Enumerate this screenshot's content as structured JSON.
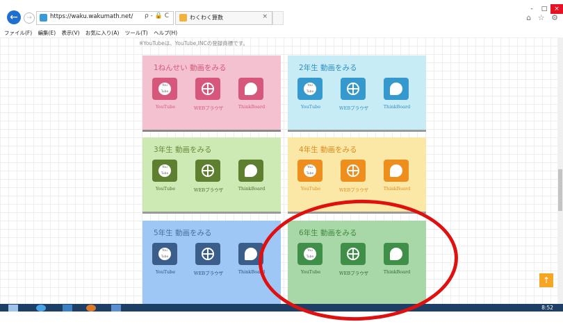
{
  "browser": {
    "url": "https://waku.wakumath.net/",
    "address_controls": "ρ - 🔒 C",
    "tab_title": "わくわく算数",
    "tab_close": "×",
    "window_controls": [
      "-",
      "□",
      "×"
    ],
    "right_icons": "⌂ ☆ ⚙"
  },
  "menu": [
    "ファイル(F)",
    "編集(E)",
    "表示(V)",
    "お気に入り(A)",
    "ツール(T)",
    "ヘルプ(H)"
  ],
  "notice": "※YouTubeは、YouTube,INCの登録商標です。",
  "button_icons": {
    "youtube": "youtube-icon",
    "web": "globe-icon",
    "think": "thinkboard-icon",
    "youtube_glyph": "You Tube"
  },
  "panels": [
    {
      "id": "grade1",
      "title": "1ねんせい 動画をみる",
      "color": "#f3c1cf"
    },
    {
      "id": "grade2",
      "title": "2年生 動画をみる",
      "color": "#c8ecf6"
    },
    {
      "id": "grade3",
      "title": "3年生 動画をみる",
      "color": "#cdeab5"
    },
    {
      "id": "grade4",
      "title": "4年生 動画をみる",
      "color": "#fbe8a6"
    },
    {
      "id": "grade5",
      "title": "5年生 動画をみる",
      "color": "#9ec7f5"
    },
    {
      "id": "grade6",
      "title": "6年生 動画をみる",
      "color": "#a8d8a8"
    }
  ],
  "labels": {
    "youtube": "YouTube",
    "web": "WEBブラウザ",
    "think": "ThinkBoard"
  },
  "page_top_arrow": "↑",
  "taskbar": {
    "clock": "8:52"
  },
  "annotation_color": "#e01010"
}
